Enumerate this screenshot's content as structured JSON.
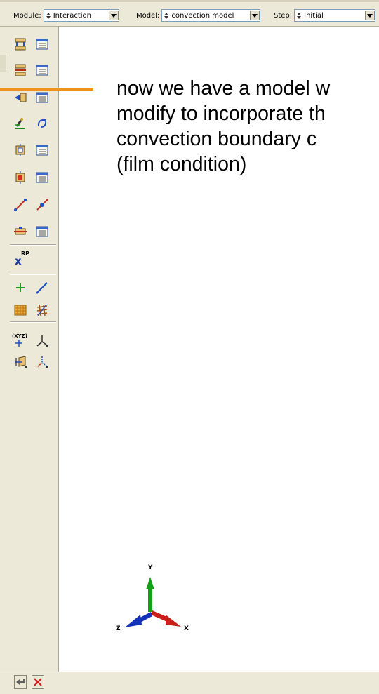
{
  "context_bar": {
    "module": {
      "label": "Module:",
      "value": "Interaction"
    },
    "model": {
      "label": "Model:",
      "value": "convection model"
    },
    "step": {
      "label": "Step:",
      "value": "Initial"
    }
  },
  "toolbox": {
    "rows": [
      {
        "left_icon": "create-interaction-icon",
        "right_icon": "interaction-manager-icon"
      },
      {
        "left_icon": "create-interaction-property-icon",
        "right_icon": "interaction-property-manager-icon"
      },
      {
        "left_icon": "create-contact-control-icon",
        "right_icon": "contact-control-manager-icon"
      },
      {
        "left_icon": "find-contact-pairs-icon",
        "right_icon": "contact-initialization-icon"
      },
      {
        "left_icon": "create-constraint-icon",
        "right_icon": "constraint-manager-icon"
      },
      {
        "left_icon": "create-connector-section-icon",
        "right_icon": "connector-section-manager-icon"
      },
      {
        "left_icon": "create-wire-feature-icon",
        "right_icon": "connector-assignment-icon"
      },
      {
        "left_icon": "create-inertia-icon",
        "right_icon": "inertia-manager-icon"
      }
    ],
    "rp": {
      "superscript": "RP",
      "glyph": "x"
    },
    "datum_csys_label": "(XYZ)"
  },
  "annotation": {
    "lines": [
      "now we have a model w",
      "modify to incorporate th",
      "convection boundary c",
      "(film condition)"
    ],
    "line_color": "#f0921e"
  },
  "triad": {
    "x_label": "X",
    "y_label": "Y",
    "z_label": "Z",
    "x_color": "#c8201a",
    "y_color": "#16a01a",
    "z_color": "#1230b8"
  }
}
